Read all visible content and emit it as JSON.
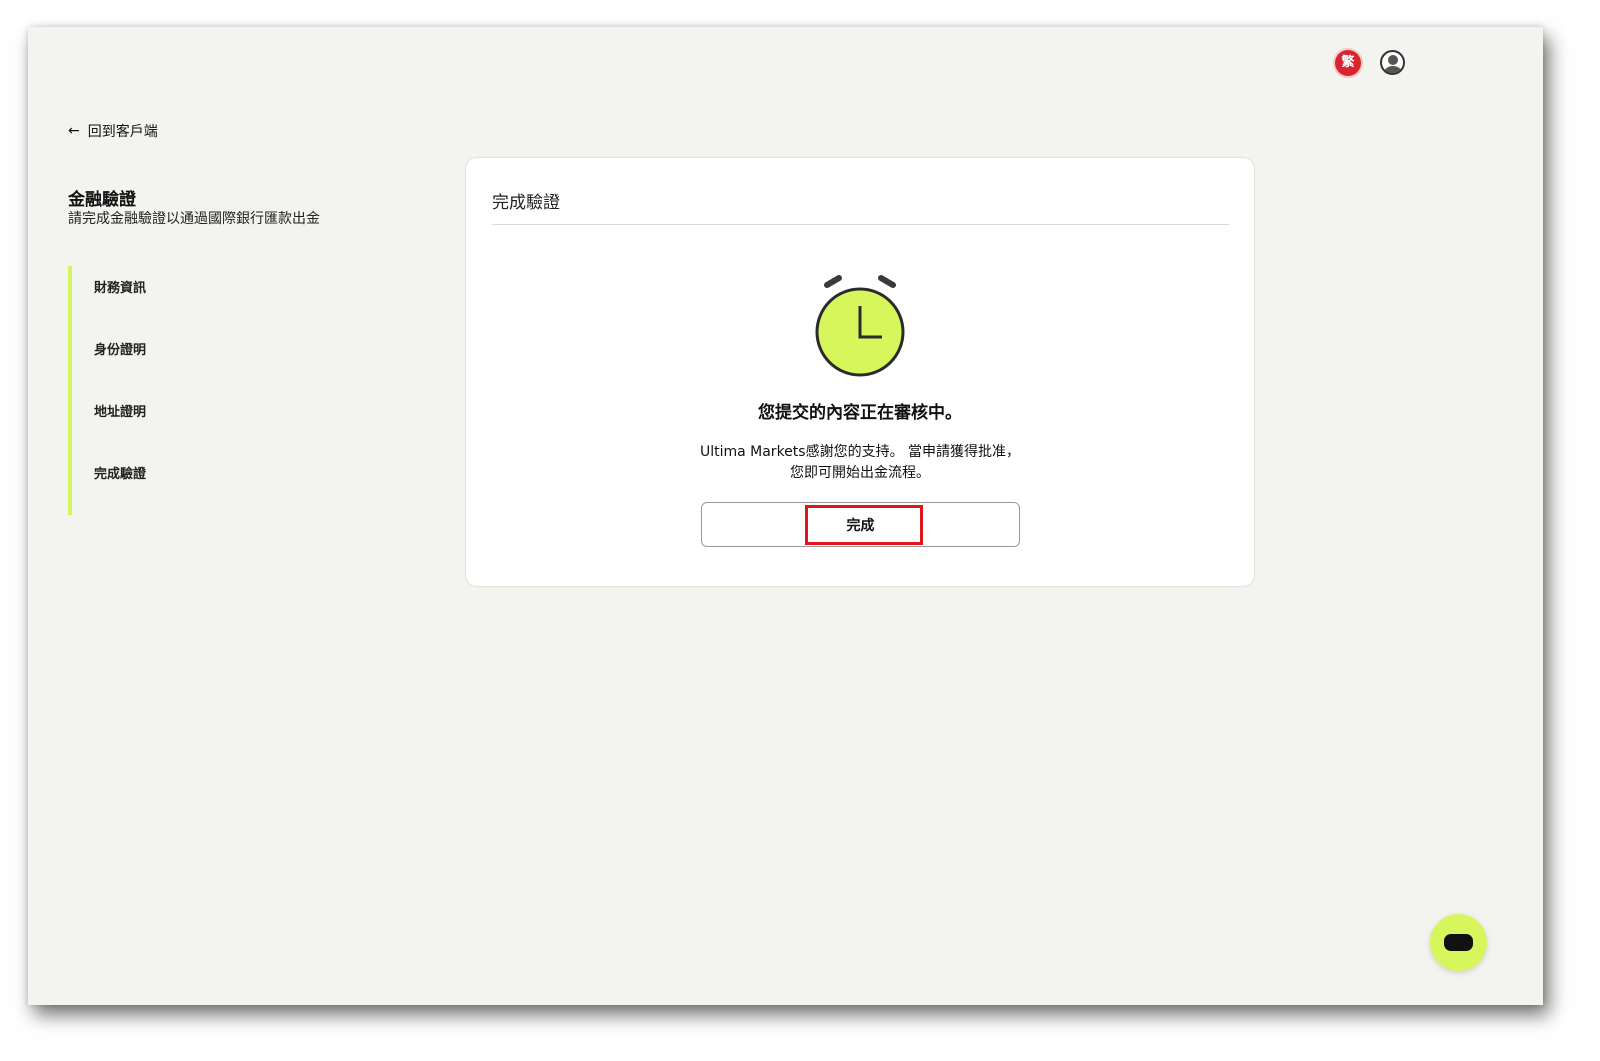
{
  "header": {
    "language_badge": "繁",
    "user_icon": "user-avatar-icon"
  },
  "back_link": {
    "icon": "arrow-left-icon",
    "label": "回到客戶端"
  },
  "sidebar": {
    "title": "金融驗證",
    "subtitle": "請完成金融驗證以通過國際銀行匯款出金",
    "steps": [
      {
        "label": "財務資訊"
      },
      {
        "label": "身份證明"
      },
      {
        "label": "地址證明"
      },
      {
        "label": "完成驗證"
      }
    ]
  },
  "card": {
    "title": "完成驗證",
    "icon": "alarm-clock-icon",
    "heading": "您提交的內容正在審核中。",
    "message_line1": "Ultima Markets感謝您的支持。 當申請獲得批准，",
    "message_line2": "您即可開始出金流程。",
    "button_label": "完成"
  },
  "colors": {
    "accent": "#d6f65c",
    "background": "#f3f3ef",
    "highlight": "#e0161c",
    "language_badge": "#d8252d"
  },
  "chat": {
    "icon": "chat-bubble-icon"
  }
}
